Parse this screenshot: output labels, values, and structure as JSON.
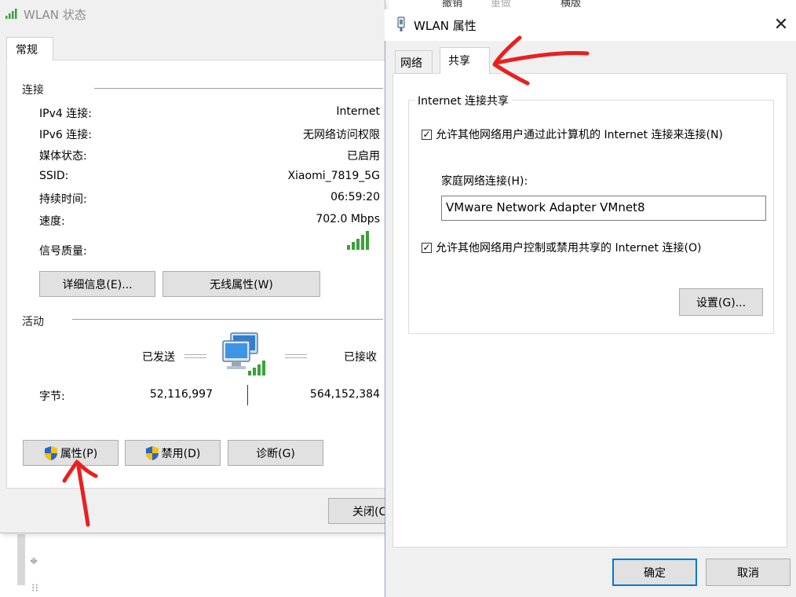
{
  "background": {
    "top_menu": [
      "撤销",
      "重做",
      "横版"
    ]
  },
  "status_window": {
    "title": "WLAN 状态",
    "tab": "常规",
    "connection": {
      "heading": "连接",
      "rows": [
        {
          "label": "IPv4 连接:",
          "value": "Internet"
        },
        {
          "label": "IPv6 连接:",
          "value": "无网络访问权限"
        },
        {
          "label": "媒体状态:",
          "value": "已启用"
        },
        {
          "label": "SSID:",
          "value": "Xiaomi_7819_5G"
        },
        {
          "label": "持续时间:",
          "value": "06:59:20"
        },
        {
          "label": "速度:",
          "value": "702.0 Mbps"
        }
      ],
      "signal_label": "信号质量:",
      "signal_bars": 5,
      "details_button": "详细信息(E)...",
      "wireless_props_button": "无线属性(W)"
    },
    "activity": {
      "heading": "活动",
      "sent_label": "已发送",
      "received_label": "已接收",
      "bytes_label": "字节:",
      "bytes_sent": "52,116,997",
      "bytes_received": "564,152,384"
    },
    "buttons": {
      "properties": "属性(P)",
      "disable": "禁用(D)",
      "diagnose": "诊断(G)",
      "close": "关闭(C)"
    }
  },
  "props_dialog": {
    "title": "WLAN 属性",
    "close_glyph": "✕",
    "tabs": [
      "网络",
      "共享"
    ],
    "active_tab": "共享",
    "group_title": "Internet 连接共享",
    "allow_connect": {
      "label": "允许其他网络用户通过此计算机的 Internet 连接来连接(N)",
      "checked": true
    },
    "home_network_label": "家庭网络连接(H):",
    "home_network_value": "VMware Network Adapter VMnet8",
    "allow_control": {
      "label": "允许其他网络用户控制或禁用共享的 Internet 连接(O)",
      "checked": true
    },
    "settings_button": "设置(G)...",
    "ok_button": "确定",
    "cancel_button": "取消"
  },
  "colors": {
    "annotation_red": "#e8201f",
    "signal_green": "#3aa13a",
    "focus_blue": "#0078d7"
  }
}
